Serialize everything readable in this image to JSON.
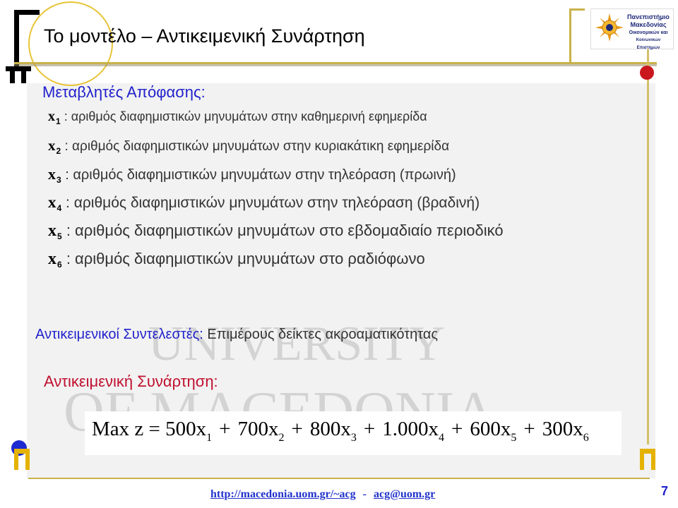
{
  "slide": {
    "title": "Το μοντέλο – Αντικειμενική Συνάρτηση",
    "decision_heading": "Μεταβλητές Απόφασης:",
    "variables": [
      {
        "symbol": "x",
        "index": "1",
        "description": ": αριθμός διαφημιστικών μηνυμάτων στην καθημερινή εφημερίδα"
      },
      {
        "symbol": "x",
        "index": "2",
        "description": ": αριθμός διαφημιστικών μηνυμάτων στην κυριακάτικη εφημερίδα"
      },
      {
        "symbol": "x",
        "index": "3",
        "description": ": αριθμός διαφημιστικών μηνυμάτων στην τηλεόραση (πρωινή)"
      },
      {
        "symbol": "x",
        "index": "4",
        "description": ": αριθμός διαφημιστικών μηνυμάτων στην τηλεόραση (βραδινή)"
      },
      {
        "symbol": "x",
        "index": "5",
        "description": ": αριθμός διαφημιστικών μηνυμάτων στο εβδομαδιαίο περιοδικό"
      },
      {
        "symbol": "x",
        "index": "6",
        "description": ": αριθμός διαφημιστικών μηνυμάτων στο ραδιόφωνο"
      }
    ],
    "coefficients_label": "Αντικειμενικοί Συντελεστές:",
    "coefficients_text": "Επιμέρους δείκτες ακροαματικότητας",
    "objective_label": "Αντικειμενική Συνάρτηση:",
    "formula": {
      "prefix": "Max z = ",
      "terms": [
        {
          "coef": "500",
          "var": "x",
          "index": "1"
        },
        {
          "coef": "700",
          "var": "x",
          "index": "2"
        },
        {
          "coef": "800",
          "var": "x",
          "index": "3"
        },
        {
          "coef": "1.000",
          "var": "x",
          "index": "4"
        },
        {
          "coef": "600",
          "var": "x",
          "index": "5"
        },
        {
          "coef": "300",
          "var": "x",
          "index": "6"
        }
      ],
      "operator": "+"
    },
    "footer": {
      "link1": "http://macedonia.uom.gr/~acg",
      "separator": "-",
      "link2": "acg@uom.gr"
    },
    "page_number": "7",
    "logo": {
      "line1": "Πανεπιστήμιο",
      "line2": "Μακεδονίας",
      "line3": "Οικονομικών και",
      "line4": "Κοινωνικών Επιστημών",
      "icon": "sun-emblem-icon"
    },
    "watermark_lines": [
      "UNIVERSITY",
      "OF MACEDONIA"
    ],
    "colors": {
      "heading_blue": "#2222cc",
      "objective_red": "#c0102e",
      "accent_gold": "#c9b24a",
      "dot_red": "#c9171d",
      "dot_blue": "#1c2ad0",
      "stub_yellow": "#e4b200"
    }
  }
}
